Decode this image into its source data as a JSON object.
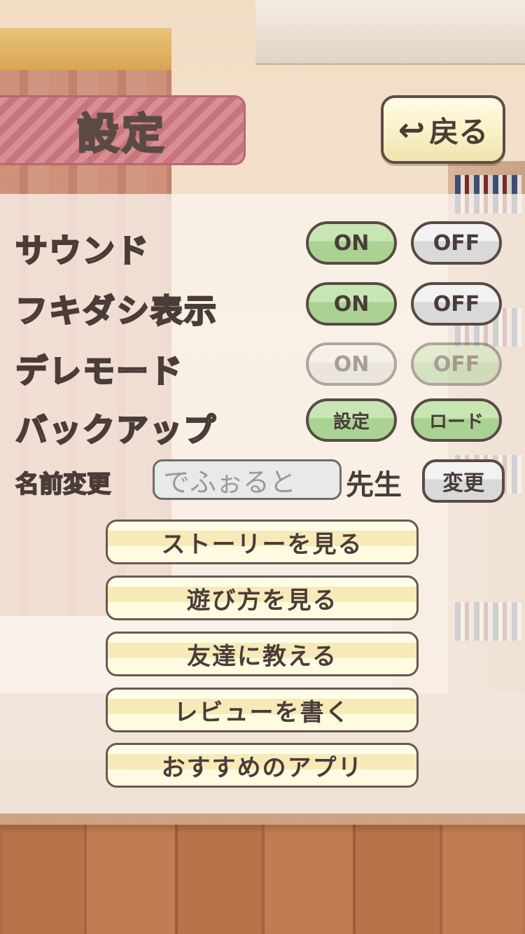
{
  "header": {
    "title": "設定",
    "back_icon": "↩",
    "back_label": "戻る"
  },
  "settings": {
    "sound": {
      "label": "サウンド",
      "on": "ON",
      "off": "OFF",
      "selected": "ON"
    },
    "bubble": {
      "label": "フキダシ表示",
      "on": "ON",
      "off": "OFF",
      "selected": "ON"
    },
    "dere": {
      "label": "デレモード",
      "on": "ON",
      "off": "OFF",
      "enabled": false
    },
    "backup": {
      "label": "バックアップ",
      "save": "設定",
      "load": "ロード"
    }
  },
  "name": {
    "label": "名前変更",
    "value": "でふぉると",
    "suffix": "先生",
    "change": "変更"
  },
  "menu": [
    "ストーリーを見る",
    "遊び方を見る",
    "友達に教える",
    "レビューを書く",
    "おすすめのアプリ"
  ],
  "colors": {
    "accent_pink": "#d98e94",
    "toggle_green": "#a9d293",
    "button_cream": "#f6eab8",
    "outline_brown": "#5a4a44"
  }
}
